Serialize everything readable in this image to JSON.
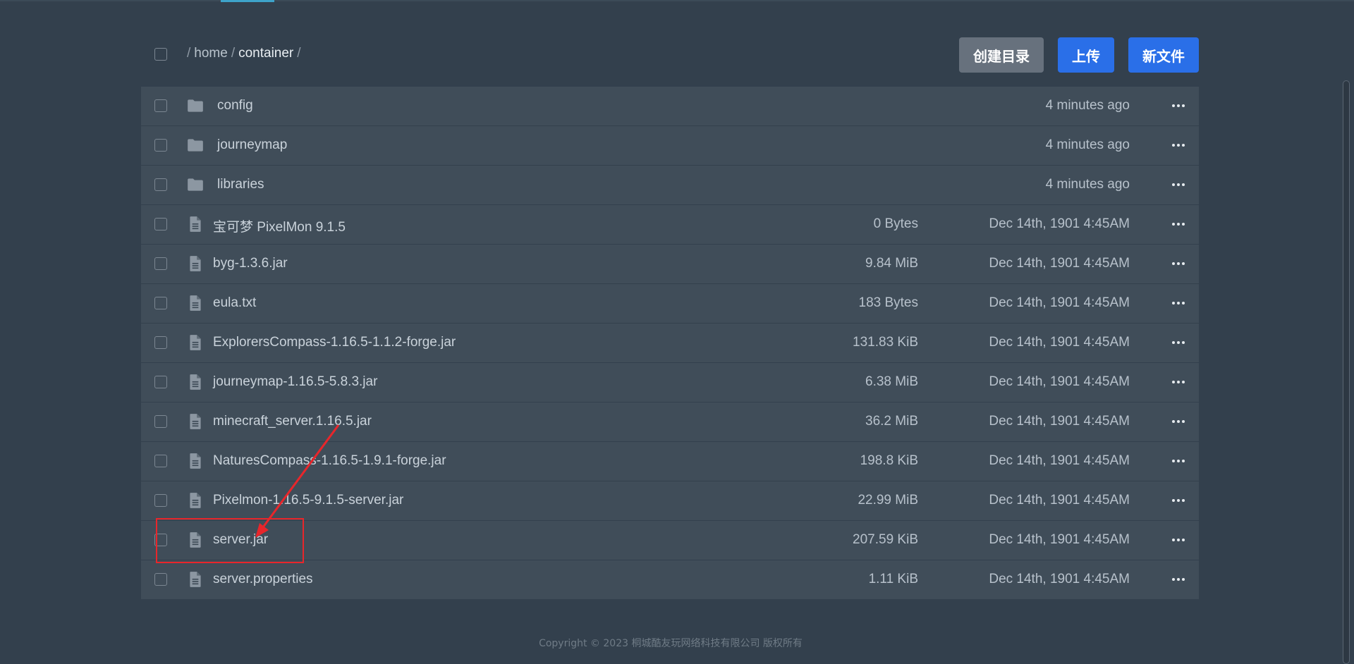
{
  "header": {
    "breadcrumb": {
      "root_sep": "/",
      "segment1": "home",
      "sep": "/",
      "current": "container",
      "trailing_sep": "/"
    },
    "buttons": {
      "mkdir": "创建目录",
      "upload": "上传",
      "newfile": "新文件"
    }
  },
  "files": [
    {
      "type": "folder",
      "name": "config",
      "size": "",
      "modified": "4 minutes ago"
    },
    {
      "type": "folder",
      "name": "journeymap",
      "size": "",
      "modified": "4 minutes ago"
    },
    {
      "type": "folder",
      "name": "libraries",
      "size": "",
      "modified": "4 minutes ago"
    },
    {
      "type": "file",
      "name": "宝可梦 PixelMon 9.1.5",
      "size": "0 Bytes",
      "modified": "Dec 14th, 1901 4:45AM"
    },
    {
      "type": "file",
      "name": "byg-1.3.6.jar",
      "size": "9.84 MiB",
      "modified": "Dec 14th, 1901 4:45AM"
    },
    {
      "type": "file",
      "name": "eula.txt",
      "size": "183 Bytes",
      "modified": "Dec 14th, 1901 4:45AM"
    },
    {
      "type": "file",
      "name": "ExplorersCompass-1.16.5-1.1.2-forge.jar",
      "size": "131.83 KiB",
      "modified": "Dec 14th, 1901 4:45AM"
    },
    {
      "type": "file",
      "name": "journeymap-1.16.5-5.8.3.jar",
      "size": "6.38 MiB",
      "modified": "Dec 14th, 1901 4:45AM"
    },
    {
      "type": "file",
      "name": "minecraft_server.1.16.5.jar",
      "size": "36.2 MiB",
      "modified": "Dec 14th, 1901 4:45AM"
    },
    {
      "type": "file",
      "name": "NaturesCompass-1.16.5-1.9.1-forge.jar",
      "size": "198.8 KiB",
      "modified": "Dec 14th, 1901 4:45AM"
    },
    {
      "type": "file",
      "name": "Pixelmon-1.16.5-9.1.5-server.jar",
      "size": "22.99 MiB",
      "modified": "Dec 14th, 1901 4:45AM"
    },
    {
      "type": "file",
      "name": "server.jar",
      "size": "207.59 KiB",
      "modified": "Dec 14th, 1901 4:45AM"
    },
    {
      "type": "file",
      "name": "server.properties",
      "size": "1.11 KiB",
      "modified": "Dec 14th, 1901 4:45AM"
    }
  ],
  "footer": {
    "copyright": "Copyright © 2023 桐城酷友玩网络科技有限公司 版权所有"
  },
  "colors": {
    "background": "#33404d",
    "row": "#404d59",
    "primary": "#2a6fe8",
    "secondary": "#67717d",
    "annotation": "#e8262b"
  },
  "icons": {
    "folder": "folder-icon",
    "file": "file-icon",
    "more": "more-options-icon"
  }
}
